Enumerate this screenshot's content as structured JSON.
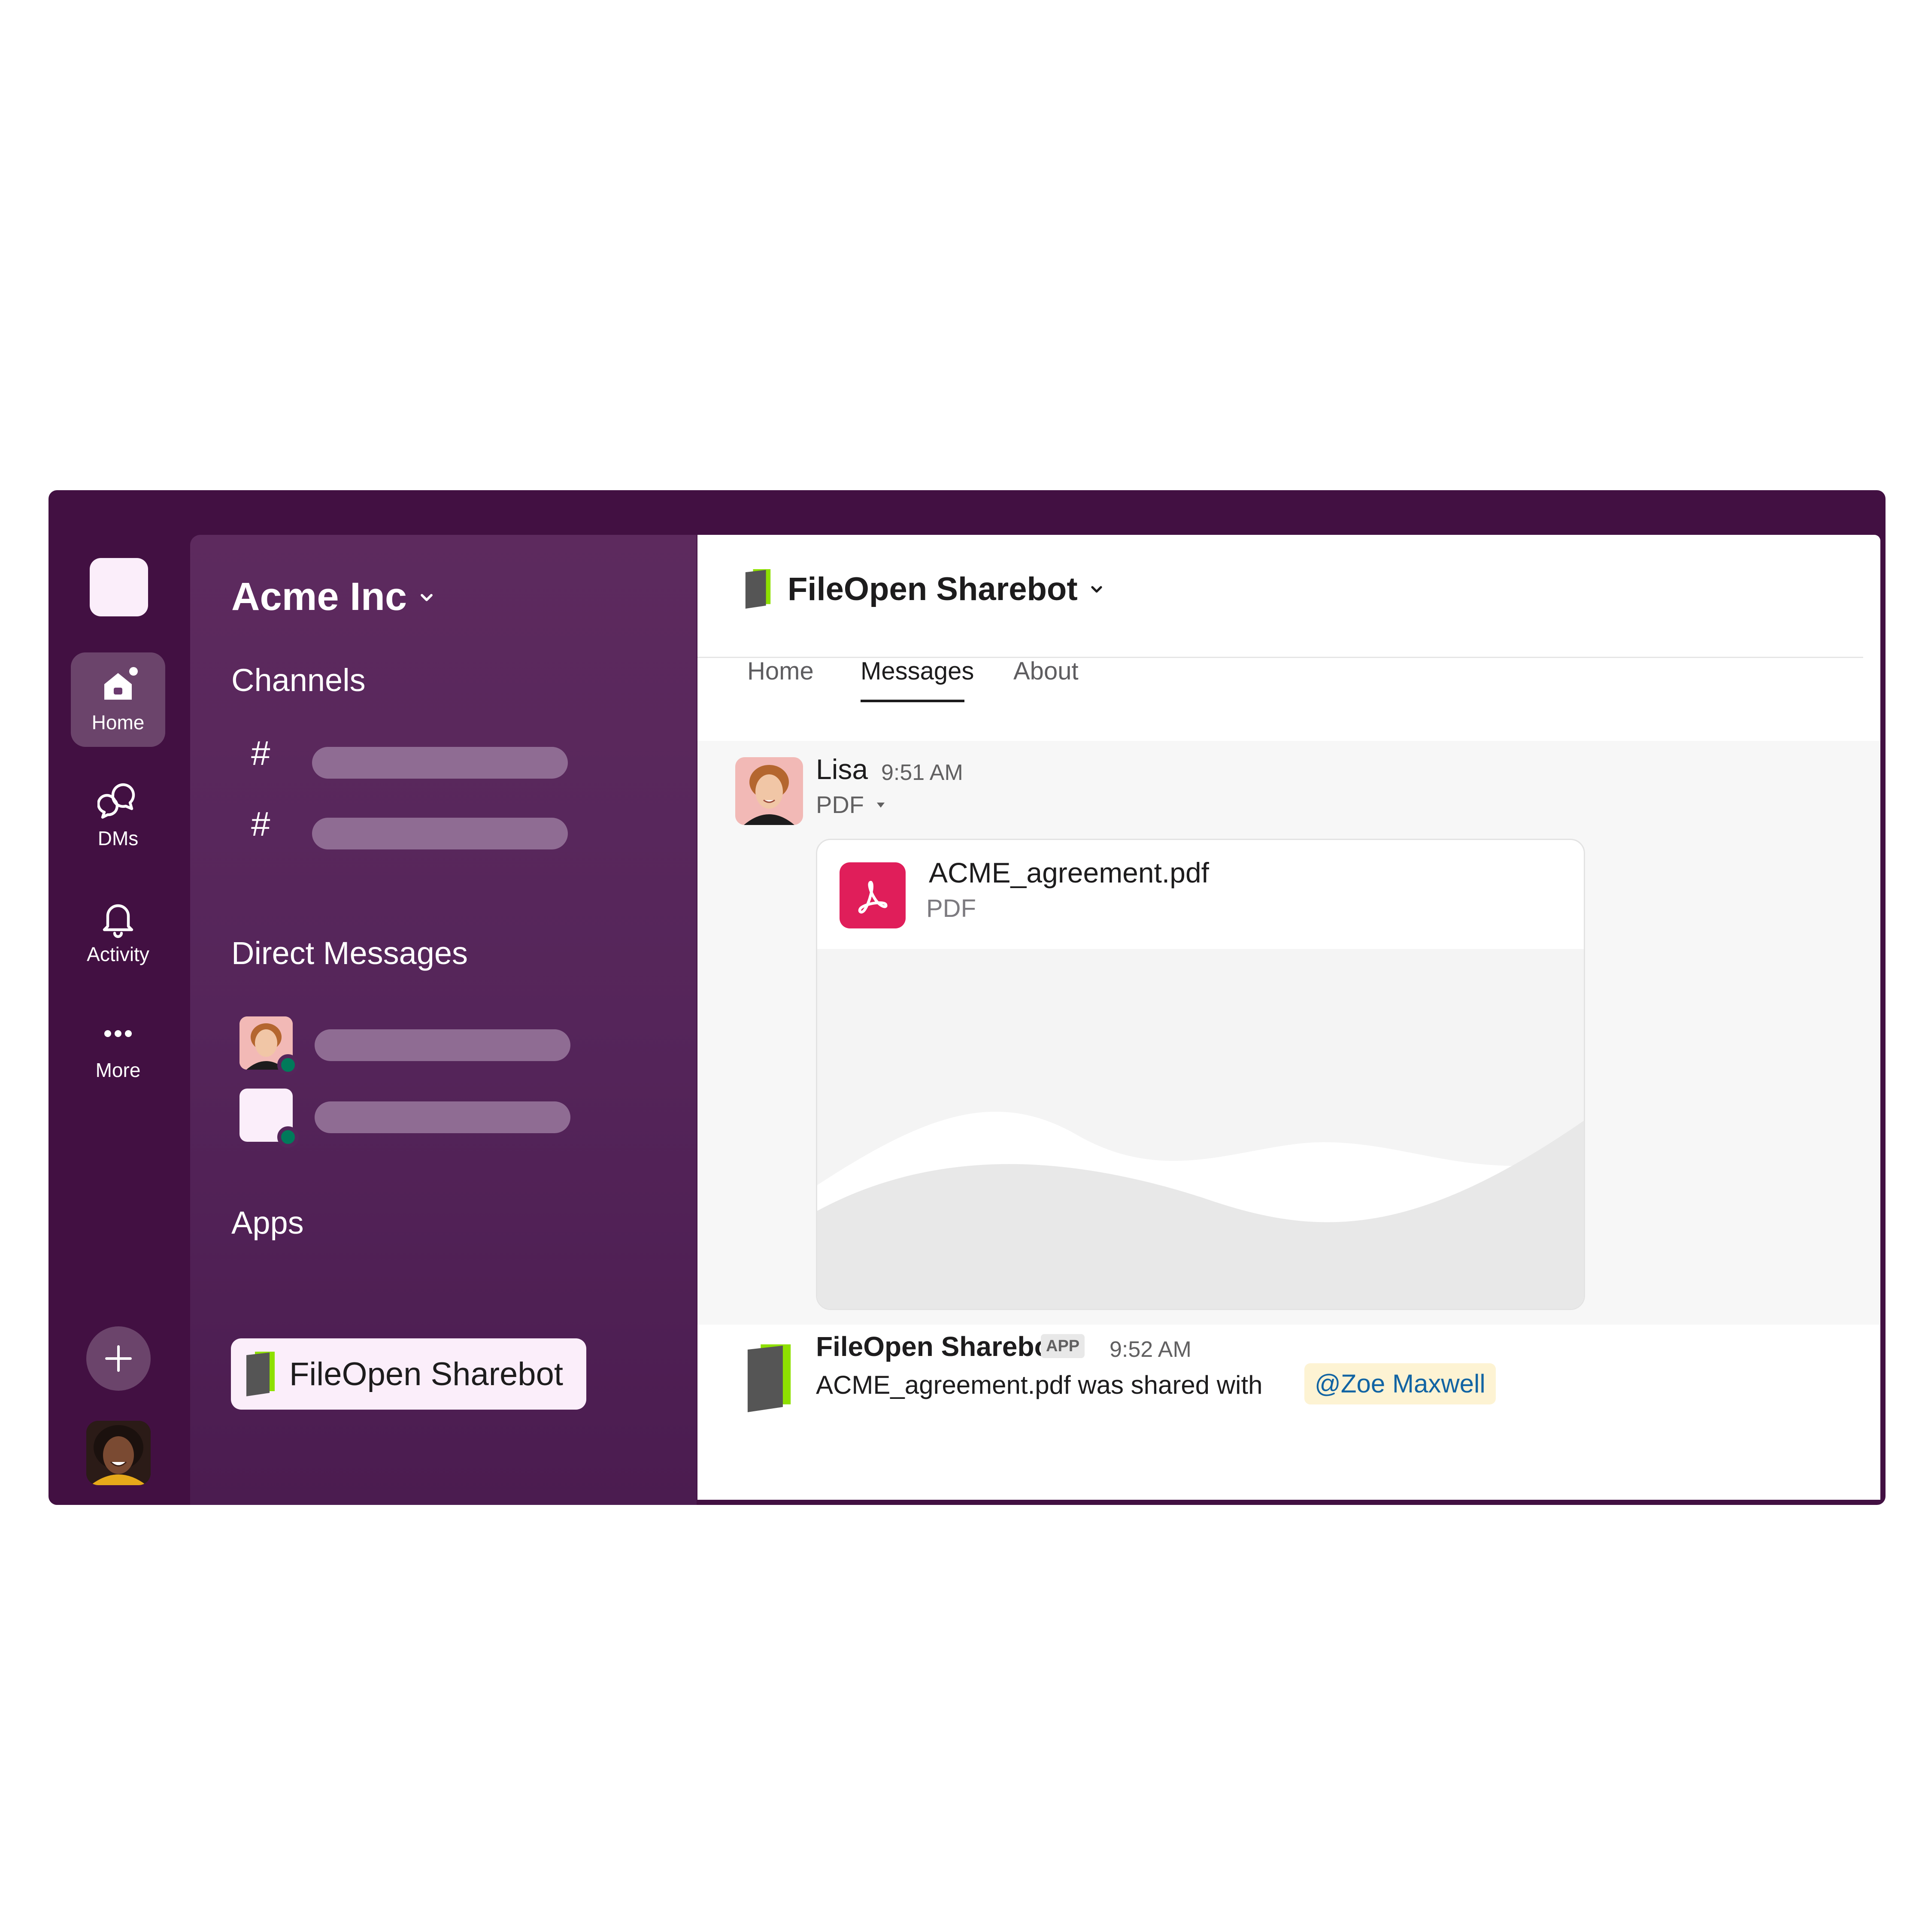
{
  "colors": {
    "brand_aubergine": "#421042",
    "sidebar": "#55255a",
    "active_item": "#fbeefa",
    "presence": "#007a5a",
    "pdf_red": "#e01e5a",
    "mention_bg": "#fdf3d3",
    "mention_text": "#1264a3",
    "bot_green": "#8ee000"
  },
  "rail": {
    "items": [
      {
        "label": "Home",
        "icon": "home-icon",
        "active": true
      },
      {
        "label": "DMs",
        "icon": "chat-bubbles-icon"
      },
      {
        "label": "Activity",
        "icon": "bell-icon"
      },
      {
        "label": "More",
        "icon": "more-dots-icon"
      }
    ],
    "add_icon": "plus-icon"
  },
  "sidebar": {
    "workspace_name": "Acme Inc",
    "channels_heading": "Channels",
    "channel_prefix": "#",
    "dms_heading": "Direct Messages",
    "apps_heading": "Apps",
    "app_item_label": "FileOpen Sharebot"
  },
  "header": {
    "title": "FileOpen Sharebot",
    "tabs": [
      {
        "label": "Home"
      },
      {
        "label": "Messages",
        "active": true
      },
      {
        "label": "About"
      }
    ]
  },
  "messages": [
    {
      "sender": "Lisa",
      "time": "9:51 AM",
      "file_type_toggle": "PDF",
      "file": {
        "name": "ACME_agreement.pdf",
        "type": "PDF",
        "icon": "pdf-icon"
      }
    },
    {
      "sender": "FileOpen Sharebot",
      "badge": "APP",
      "time": "9:52 AM",
      "text": "ACME_agreement.pdf was shared with",
      "mention": "@Zoe Maxwell"
    }
  ]
}
